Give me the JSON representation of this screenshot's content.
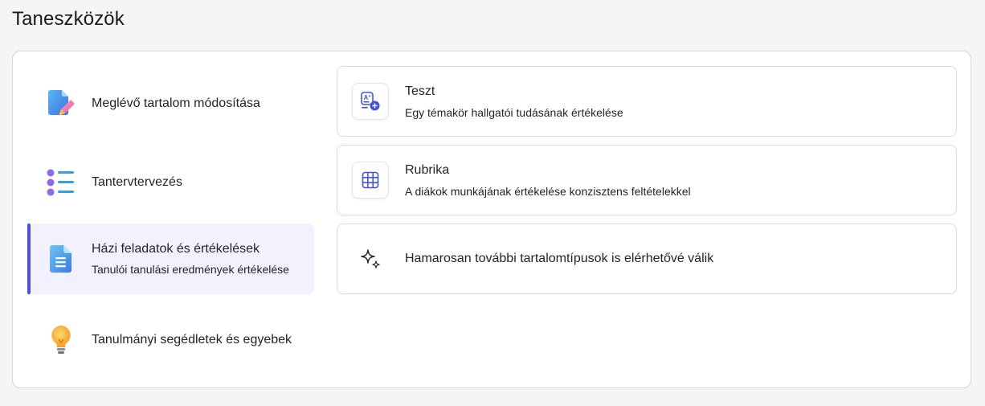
{
  "page": {
    "title": "Taneszközök"
  },
  "categories": [
    {
      "label": "Meglévő tartalom módosítása",
      "sub": "",
      "icon": "document-edit-icon"
    },
    {
      "label": "Tantervtervezés",
      "sub": "",
      "icon": "bulleted-list-icon"
    },
    {
      "label": "Házi feladatok és értékelések",
      "sub": "Tanulói tanulási eredmények értékelése",
      "icon": "document-text-icon",
      "active": true
    },
    {
      "label": "Tanulmányi segédletek és egyebek",
      "sub": "",
      "icon": "lightbulb-icon"
    }
  ],
  "cards": [
    {
      "title": "Teszt",
      "desc": "Egy témakör hallgatói tudásának értékelése",
      "icon": "quiz-add-icon"
    },
    {
      "title": "Rubrika",
      "desc": "A diákok munkájának értékelése konzisztens feltételekkel",
      "icon": "table-grid-icon"
    },
    {
      "title": "Hamarosan további tartalomtípusok is elérhetővé válik",
      "desc": "",
      "icon": "sparkle-icon"
    }
  ],
  "colors": {
    "accent": "#4f52d8",
    "active_bg": "#f3f1fd",
    "icon_blue": "#4653d6"
  }
}
